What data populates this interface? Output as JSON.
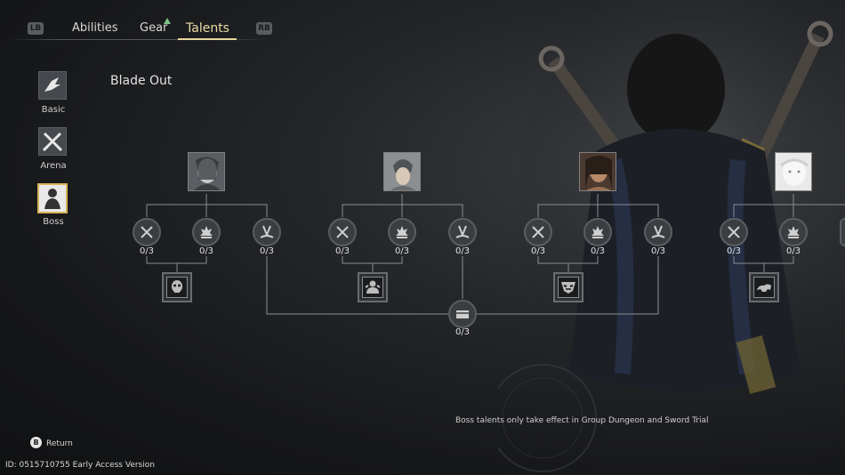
{
  "tabs": {
    "left_bumper": "LB",
    "right_bumper": "RB",
    "items": [
      {
        "label": "Abilities"
      },
      {
        "label": "Gear",
        "alert": true
      },
      {
        "label": "Talents",
        "active": true
      }
    ]
  },
  "categories": [
    {
      "label": "Basic",
      "icon": "wing-icon"
    },
    {
      "label": "Arena",
      "icon": "crossed-swords-icon"
    },
    {
      "label": "Boss",
      "icon": "boss-figure-icon",
      "active": true
    }
  ],
  "section_title": "Blade Out",
  "boss_trees": [
    {
      "portrait": "boss-portrait-1",
      "talents": [
        "0/3",
        "0/3",
        "0/3"
      ],
      "core_icon": "skull-mask-icon"
    },
    {
      "portrait": "boss-portrait-2",
      "talents": [
        "0/3",
        "0/3",
        "0/3"
      ],
      "core_icon": "armored-warrior-icon"
    },
    {
      "portrait": "boss-portrait-3",
      "talents": [
        "0/3",
        "0/3",
        "0/3"
      ],
      "core_icon": "demon-mask-icon"
    },
    {
      "portrait": "boss-portrait-4",
      "talents": [
        "0/3",
        "0/3"
      ],
      "core_icon": "beast-icon"
    }
  ],
  "shared_talent": {
    "icon": "chest-icon",
    "count": "0/3"
  },
  "notice": "Boss talents only take effect in Group Dungeon and Sword Trial",
  "return": {
    "button": "B",
    "label": "Return"
  },
  "build_id": "ID: 0515710755 Early Access Version",
  "colors": {
    "accent_gold": "#e7d89a",
    "alert_green": "#7fc48a",
    "node_bg": "#3b3e41"
  }
}
